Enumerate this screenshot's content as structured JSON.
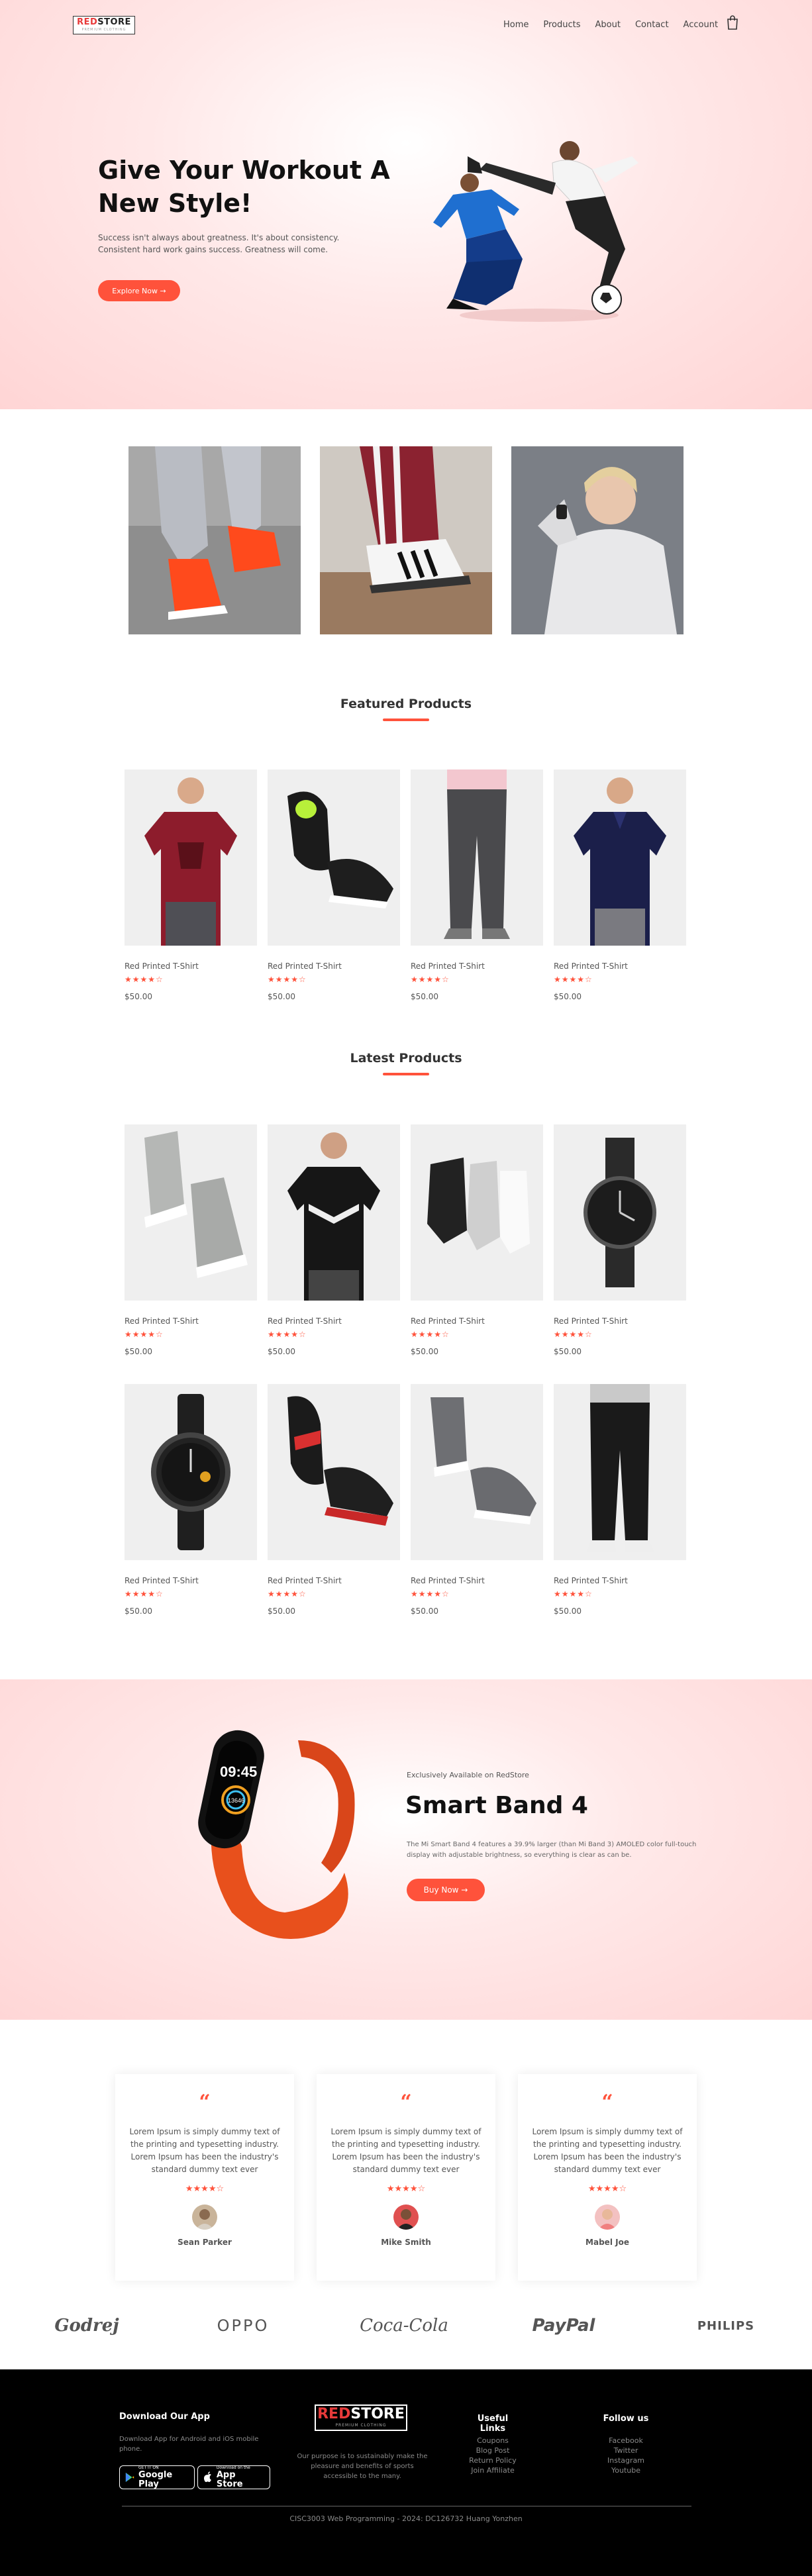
{
  "brand": {
    "logo_red": "RED",
    "logo_dark": "STORE",
    "logo_sub": "PREMIUM CLOTHING"
  },
  "nav": {
    "items": [
      "Home",
      "Products",
      "About",
      "Contact",
      "Account"
    ]
  },
  "hero": {
    "title": "Give Your Workout A New Style!",
    "text": "Success isn't always about greatness. It's about consistency. Consistent hard work gains success. Greatness will come.",
    "button": "Explore Now →"
  },
  "featured": {
    "title": "Featured Products",
    "items": [
      {
        "name": "Red Printed T-Shirt",
        "stars": "★★★★☆",
        "price": "$50.00"
      },
      {
        "name": "Red Printed T-Shirt",
        "stars": "★★★★☆",
        "price": "$50.00"
      },
      {
        "name": "Red Printed T-Shirt",
        "stars": "★★★★☆",
        "price": "$50.00"
      },
      {
        "name": "Red Printed T-Shirt",
        "stars": "★★★★☆",
        "price": "$50.00"
      }
    ]
  },
  "latest": {
    "title": "Latest Products",
    "items": [
      {
        "name": "Red Printed T-Shirt",
        "stars": "★★★★☆",
        "price": "$50.00"
      },
      {
        "name": "Red Printed T-Shirt",
        "stars": "★★★★☆",
        "price": "$50.00"
      },
      {
        "name": "Red Printed T-Shirt",
        "stars": "★★★★☆",
        "price": "$50.00"
      },
      {
        "name": "Red Printed T-Shirt",
        "stars": "★★★★☆",
        "price": "$50.00"
      },
      {
        "name": "Red Printed T-Shirt",
        "stars": "★★★★☆",
        "price": "$50.00"
      },
      {
        "name": "Red Printed T-Shirt",
        "stars": "★★★★☆",
        "price": "$50.00"
      },
      {
        "name": "Red Printed T-Shirt",
        "stars": "★★★★☆",
        "price": "$50.00"
      },
      {
        "name": "Red Printed T-Shirt",
        "stars": "★★★★☆",
        "price": "$50.00"
      }
    ]
  },
  "offer": {
    "small": "Exclusively Available on RedStore",
    "title": "Smart Band 4",
    "desc": "The Mi Smart Band 4 features a 39.9% larger (than Mi Band 3) AMOLED color full-touch display with adjustable brightness, so everything is clear as can be.",
    "button": "Buy Now →",
    "band_time": "09:45",
    "band_steps": "13646"
  },
  "testimonials": [
    {
      "quote": "“",
      "text": "Lorem Ipsum is simply dummy text of the printing and typesetting industry. Lorem Ipsum has been the industry's standard dummy text ever",
      "stars": "★★★★☆",
      "name": "Sean Parker"
    },
    {
      "quote": "“",
      "text": "Lorem Ipsum is simply dummy text of the printing and typesetting industry. Lorem Ipsum has been the industry's standard dummy text ever",
      "stars": "★★★★☆",
      "name": "Mike Smith"
    },
    {
      "quote": "“",
      "text": "Lorem Ipsum is simply dummy text of the printing and typesetting industry. Lorem Ipsum has been the industry's standard dummy text ever",
      "stars": "★★★★☆",
      "name": "Mabel Joe"
    }
  ],
  "brands": [
    "Godrej",
    "OPPO",
    "Coca-Cola",
    "PayPal",
    "PHILIPS"
  ],
  "footer": {
    "app_title": "Download Our App",
    "app_text": "Download App for Android and iOS mobile phone.",
    "google_small": "GET IT ON",
    "google_big": "Google Play",
    "apple_small": "Download on the",
    "apple_big": "App Store",
    "mission": "Our purpose is to sustainably make the pleasure and benefits of sports accessible to the many.",
    "links_title": "Useful Links",
    "links": [
      "Coupons",
      "Blog Post",
      "Return Policy",
      "Join Affiliate"
    ],
    "follow_title": "Follow us",
    "follow": [
      "Facebook",
      "Twitter",
      "Instagram",
      "Youtube"
    ],
    "copyright": "CISC3003 Web Programming - 2024: DC126732 Huang Yonzhen"
  },
  "colors": {
    "accent": "#ff523b",
    "hero_bg": "#ffd6d6",
    "footer_bg": "#000000"
  }
}
